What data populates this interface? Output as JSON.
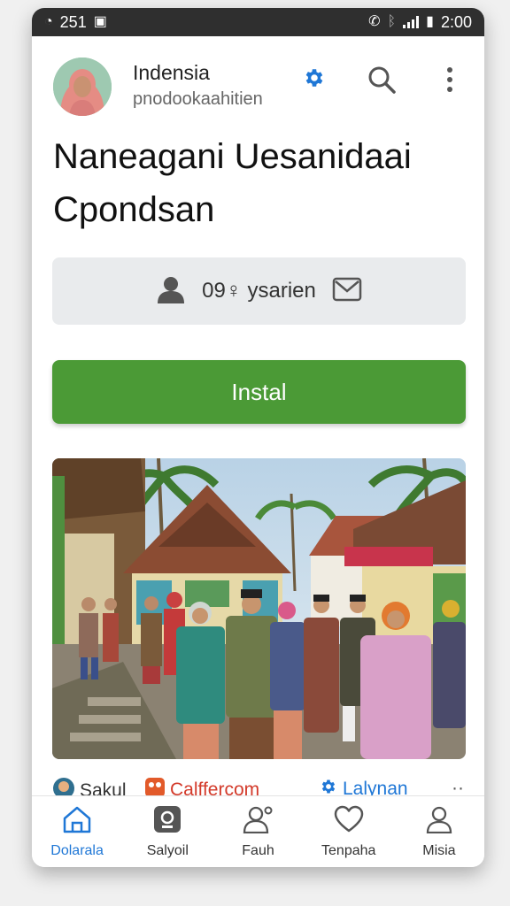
{
  "status_bar": {
    "left_text": "251",
    "time": "2:00"
  },
  "header": {
    "title": "Indensia",
    "subtitle": "pnodookaahitien"
  },
  "page_title": "Naneagani Uesanidaai Cpondsan",
  "info_row": {
    "text": "09♀ ysarien"
  },
  "install_button": {
    "label": "Instal"
  },
  "peek": [
    {
      "label": "Sakul"
    },
    {
      "label": "Calffercom"
    },
    {
      "label": "Lalynan"
    }
  ],
  "nav": [
    {
      "label": "Dolarala",
      "active": true
    },
    {
      "label": "Salyoil"
    },
    {
      "label": "Fauh"
    },
    {
      "label": "Tenpaha"
    },
    {
      "label": "Misia"
    }
  ],
  "colors": {
    "accent": "#1f77d6",
    "install": "#4b9a36",
    "status_bar": "#2f2f2f"
  }
}
